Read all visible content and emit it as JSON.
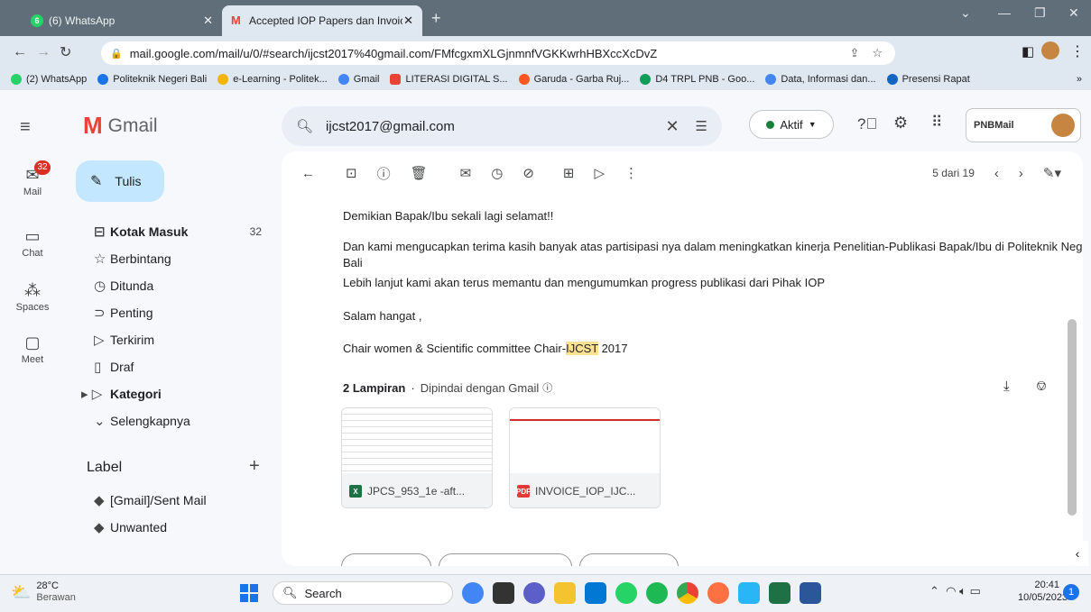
{
  "tabs": [
    {
      "label": "(6) WhatsApp",
      "favicon": "whatsapp-icon"
    },
    {
      "label": "Accepted IOP Papers dan Invoice",
      "favicon": "gmail-icon"
    }
  ],
  "address": {
    "url": "mail.google.com/mail/u/0/#search/ijcst2017%40gmail.com/FMfcgxmXLGjnmnfVGKKwrhHBXccXcDvZ"
  },
  "bookmarks": [
    {
      "label": "(2) WhatsApp",
      "color": "#25d366"
    },
    {
      "label": "Politeknik Negeri Bali",
      "color": "#1a73e8"
    },
    {
      "label": "e-Learning - Politek...",
      "color": "#f4b400"
    },
    {
      "label": "Gmail",
      "color": "#4285f4"
    },
    {
      "label": "LITERASI DIGITAL S...",
      "color": "#ea4335"
    },
    {
      "label": "Garuda - Garba Ruj...",
      "color": "#ff5722"
    },
    {
      "label": "D4 TRPL PNB - Goo...",
      "color": "#0f9d58"
    },
    {
      "label": "Data, Informasi dan...",
      "color": "#4285f4"
    },
    {
      "label": "Presensi Rapat",
      "color": "#1565c0"
    }
  ],
  "gmail": {
    "logo_text": "Gmail",
    "rail": [
      {
        "label": "Mail",
        "badge": "32"
      },
      {
        "label": "Chat"
      },
      {
        "label": "Spaces"
      },
      {
        "label": "Meet"
      }
    ],
    "compose_label": "Tulis",
    "nav": [
      {
        "label": "Kotak Masuk",
        "count": "32",
        "bold": true
      },
      {
        "label": "Berbintang",
        "count": ""
      },
      {
        "label": "Ditunda",
        "count": ""
      },
      {
        "label": "Penting",
        "count": ""
      },
      {
        "label": "Terkirim",
        "count": ""
      },
      {
        "label": "Draf",
        "count": ""
      },
      {
        "label": "Kategori",
        "count": "",
        "bold": true
      },
      {
        "label": "Selengkapnya",
        "count": ""
      }
    ],
    "label_header": "Label",
    "labels": [
      "[Gmail]/Sent Mail",
      "Unwanted"
    ],
    "search_value": "ijcst2017@gmail.com",
    "status": "Aktif",
    "account_brand": "PNBMail",
    "pagination": "5 dari 19"
  },
  "message": {
    "lines": [
      "Demikian Bapak/Ibu sekali lagi selamat!!",
      "Dan kami mengucapkan terima kasih banyak atas partisipasi nya dalam meningkatkan kinerja Penelitian-Publikasi Bapak/Ibu di Politeknik Negeri",
      "Bali",
      "Lebih lanjut kami akan terus memantu dan mengumumkan  progress publikasi dari Pihak IOP",
      "Salam hangat ,"
    ],
    "signature_prefix": "Chair women  & Scientific committee Chair-",
    "signature_highlight": "IJCST",
    "signature_suffix": " 2017",
    "attachments_title": "2 Lampiran",
    "attachments_sub": "Dipindai dengan Gmail",
    "attachments": [
      {
        "name": "JPCS_953_1e -aft...",
        "type": "xlsx",
        "color": "#1e7145"
      },
      {
        "name": "INVOICE_IOP_IJC...",
        "type": "pdf",
        "color": "#e53935"
      }
    ]
  },
  "taskbar": {
    "weather_temp": "28°C",
    "weather_desc": "Berawan",
    "search_placeholder": "Search",
    "time": "20:41",
    "date": "10/05/2023",
    "notif_count": "1"
  }
}
